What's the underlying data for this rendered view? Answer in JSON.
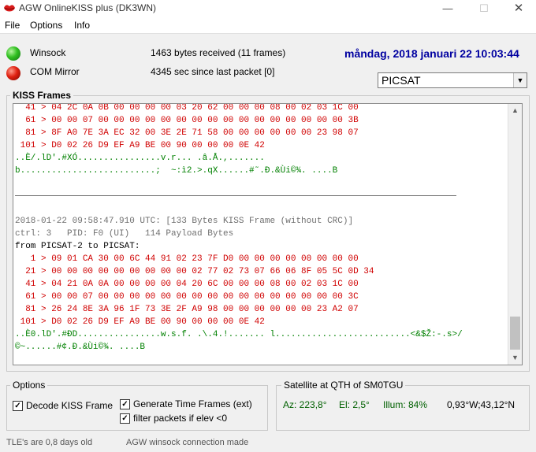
{
  "window": {
    "title": "AGW OnlineKISS plus (DK3WN)"
  },
  "menu": [
    "File",
    "Options",
    "Info"
  ],
  "status_panel": {
    "winsock_label": "Winsock",
    "winsock_info": "1463 bytes received (11 frames)",
    "com_label": "COM Mirror",
    "com_info": "4345 sec since last packet [0]",
    "datetime": "måndag, 2018 januari 22  10:03:44",
    "satellite_select": "PICSAT"
  },
  "kiss": {
    "title": "KISS Frames",
    "lines": [
      {
        "c": "red",
        "t": "  41 > 04 2C 0A 0B 00 00 00 00 03 20 62 00 00 00 08 00 02 03 1C 00"
      },
      {
        "c": "red",
        "t": "  61 > 00 00 07 00 00 00 00 00 00 00 00 00 00 00 00 00 00 00 00 3B"
      },
      {
        "c": "red",
        "t": "  81 > 8F A0 7E 3A EC 32 00 3E 2E 71 58 00 00 00 00 00 00 23 98 07"
      },
      {
        "c": "red",
        "t": " 101 > D0 02 26 D9 EF A9 BE 00 90 00 00 00 0E 42"
      },
      {
        "c": "green",
        "t": "..È/.lD'.#XÓ................v.r... .â.Å.,......."
      },
      {
        "c": "green",
        "t": "b..........................;  ~:ì2.>.qX......#˜.Ð.&Ùi©¾. ....B"
      },
      {
        "c": "blank",
        "t": ""
      },
      {
        "c": "sep",
        "t": ""
      },
      {
        "c": "blank",
        "t": ""
      },
      {
        "c": "gray",
        "t": "2018-01-22 09:58:47.910 UTC: [133 Bytes KISS Frame (without CRC)]"
      },
      {
        "c": "gray",
        "t": "ctrl: 3   PID: F0 (UI)   114 Payload Bytes"
      },
      {
        "c": "black",
        "t": "from PICSAT-2 to PICSAT:"
      },
      {
        "c": "red",
        "t": "   1 > 09 01 CA 30 00 6C 44 91 02 23 7F D0 00 00 00 00 00 00 00 00"
      },
      {
        "c": "red",
        "t": "  21 > 00 00 00 00 00 00 00 00 00 02 77 02 73 07 66 06 8F 05 5C 0D 34"
      },
      {
        "c": "red",
        "t": "  41 > 04 21 0A 0A 00 00 00 00 04 20 6C 00 00 00 08 00 02 03 1C 00"
      },
      {
        "c": "red",
        "t": "  61 > 00 00 07 00 00 00 00 00 00 00 00 00 00 00 00 00 00 00 00 3C"
      },
      {
        "c": "red",
        "t": "  81 > 26 24 8E 3A 96 1F 73 3E 2F A9 98 00 00 00 00 00 00 23 A2 07"
      },
      {
        "c": "red",
        "t": " 101 > D0 02 26 D9 EF A9 BE 00 90 00 00 00 0E 42"
      },
      {
        "c": "green",
        "t": "..È0.lD'.#ÐD................w.s.f. .\\.4.!....... l..........................<&$Ž:-.s>/"
      },
      {
        "c": "green",
        "t": "©~......#¢.Ð.&Ùi©¾. ....B"
      },
      {
        "c": "blank",
        "t": ""
      },
      {
        "c": "sep",
        "t": ""
      }
    ]
  },
  "options": {
    "title": "Options",
    "decode_kiss": {
      "label": "Decode KISS Frame",
      "checked": true
    },
    "generate_time": {
      "label": "Generate Time Frames (ext)",
      "checked": true
    },
    "filter_packets": {
      "label": "filter packets if elev <0",
      "checked": true
    }
  },
  "satellite": {
    "title": "Satellite at QTH of SM0TGU",
    "az": "Az: 223,8°",
    "el": "El: 2,5°",
    "illum": "Illum: 84%",
    "coords": "0,93°W;43,12°N"
  },
  "statusbar": {
    "tle_age": "TLE's are 0,8 days old",
    "connection": "AGW winsock connection made"
  },
  "colors": {
    "date": "#0000a0",
    "hex_lines": "#d00000",
    "ascii_lines": "#008000",
    "header_lines": "#707070",
    "led_winsock": "#30c020",
    "led_com": "#e02010"
  }
}
